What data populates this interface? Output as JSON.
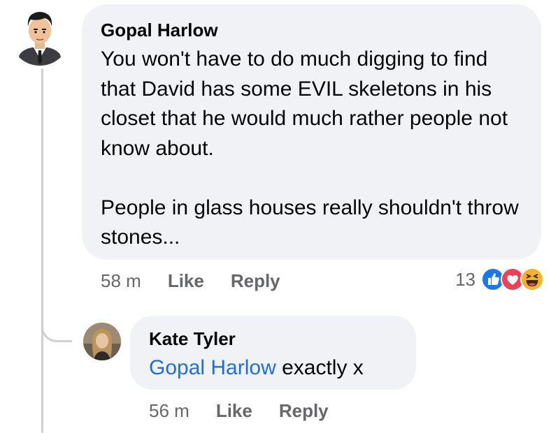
{
  "comment": {
    "author": "Gopal Harlow",
    "paragraphs": [
      "You won't have to do much digging to find that David has some EVIL skeletons in his closet that he would much rather people not know about.",
      "People in glass houses really shouldn't throw stones..."
    ],
    "time": "58 m",
    "like_label": "Like",
    "reply_label": "Reply",
    "reaction_count": "13",
    "reactions": [
      "like-icon",
      "love-icon",
      "haha-icon"
    ],
    "colors": {
      "like": "#1877f2",
      "love": "#f33e58",
      "haha": "#f7b125"
    }
  },
  "reply": {
    "author": "Kate Tyler",
    "mention": "Gopal Harlow",
    "text": " exactly x",
    "time": "56 m",
    "like_label": "Like",
    "reply_label": "Reply"
  }
}
